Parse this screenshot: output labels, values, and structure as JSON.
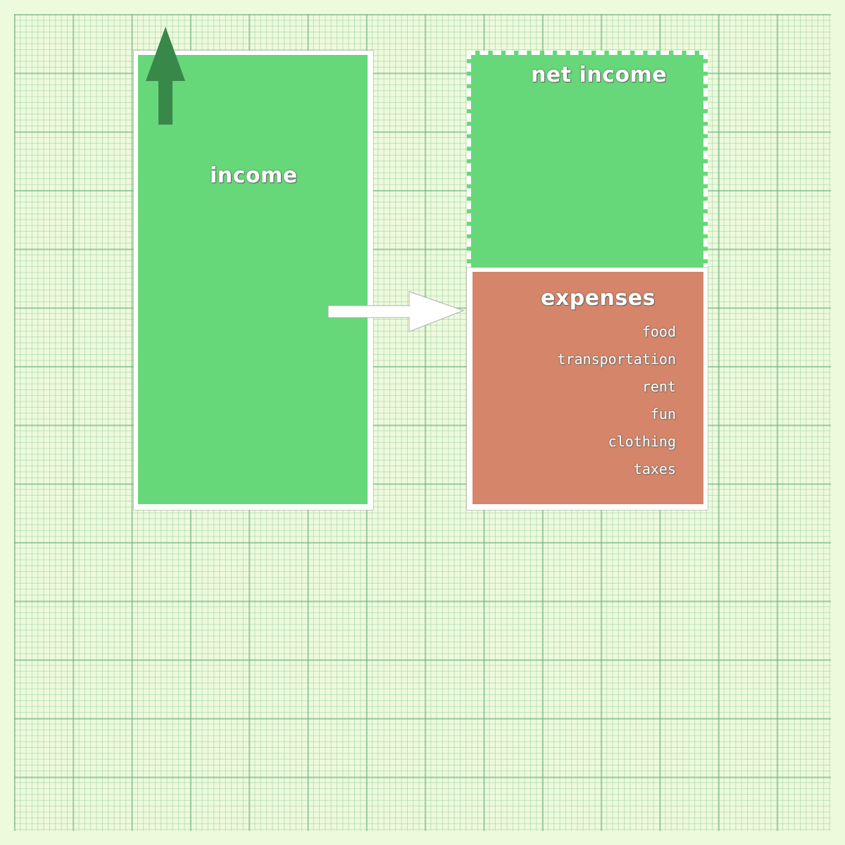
{
  "diagram": {
    "income": {
      "label": "income",
      "color": "#66d879"
    },
    "net_income": {
      "label": "net income",
      "color": "#66d879"
    },
    "expenses": {
      "label": "expenses",
      "color": "#d5866a",
      "items": [
        "food",
        "transportation",
        "rent",
        "fun",
        "clothing",
        "taxes"
      ]
    },
    "up_arrow_color": "#38884a",
    "flow_arrow_color": "#ffffff"
  }
}
